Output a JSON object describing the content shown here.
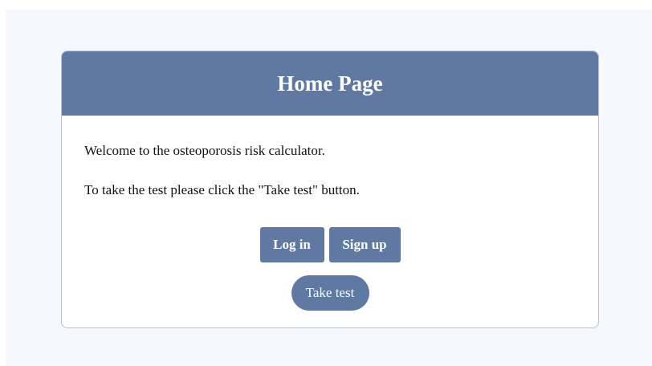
{
  "header": {
    "title": "Home Page"
  },
  "content": {
    "welcome": "Welcome to the osteoporosis risk calculator.",
    "instruction": "To take the test please click the \"Take test\" button."
  },
  "buttons": {
    "login": "Log in",
    "signup": "Sign up",
    "take_test": "Take test"
  },
  "colors": {
    "accent": "#5f79a3",
    "page_background": "#f7f8fe",
    "card_border": "#b9c2d1"
  }
}
